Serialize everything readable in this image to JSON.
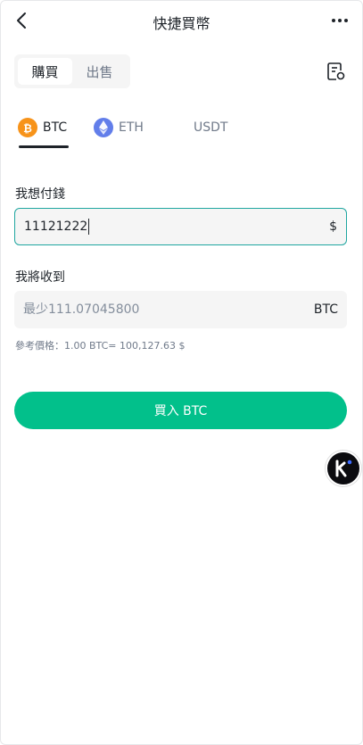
{
  "header": {
    "title": "快捷買幣"
  },
  "segment": {
    "buy": "購買",
    "sell": "出售"
  },
  "coins": [
    {
      "label": "BTC",
      "icon": "bitcoin-icon",
      "color": "#f7931a"
    },
    {
      "label": "ETH",
      "icon": "ethereum-icon",
      "color": "#627eea"
    },
    {
      "label": "USDT",
      "icon": "",
      "color": ""
    }
  ],
  "pay": {
    "label": "我想付錢",
    "value": "11121222",
    "suffix": "$"
  },
  "receive": {
    "label": "我將收到",
    "placeholder": "最少111.07045800",
    "suffix": "BTC"
  },
  "ref_price": "參考價格：1.00 BTC= 100,127.63 $",
  "buy_button": "買入 BTC",
  "colors": {
    "accent": "#02c08b",
    "input_border": "#1fa6a0"
  }
}
